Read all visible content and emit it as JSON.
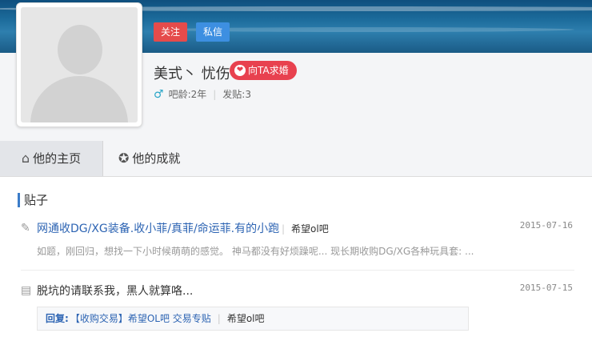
{
  "header": {
    "follow_label": "关注",
    "message_label": "私信"
  },
  "profile": {
    "username": "美式丶 忧伤",
    "propose_label": "向TA求婚",
    "gender_icon": "male-icon",
    "tenure": "吧龄:2年",
    "posts": "发贴:3"
  },
  "tabs": [
    {
      "label": "他的主页",
      "icon": "home-icon"
    },
    {
      "label": "他的成就",
      "icon": "medal-icon"
    }
  ],
  "section": {
    "title": "贴子"
  },
  "posts": [
    {
      "icon": "edit-icon",
      "title": "网通收DG/XG装备.收小菲/真菲/命运菲.有的小跑",
      "forum": "希望ol吧",
      "date": "2015-07-16",
      "excerpt": "如题，刚回归，想找一下小时候萌萌的感觉。 神马都没有好烦躁呢... 现长期收购DG/XG各种玩具套: ..."
    },
    {
      "icon": "comment-icon",
      "title": "脱坑的请联系我，黑人就算咯...",
      "date": "2015-07-15",
      "reply": {
        "label": "回复:",
        "target": "【收购交易】希望OL吧 交易专贴",
        "forum": "希望ol吧"
      }
    }
  ],
  "colors": {
    "follow": "#e54b4b",
    "message": "#3d8fe1",
    "propose": "#e8414f",
    "link": "#2d64b3"
  }
}
